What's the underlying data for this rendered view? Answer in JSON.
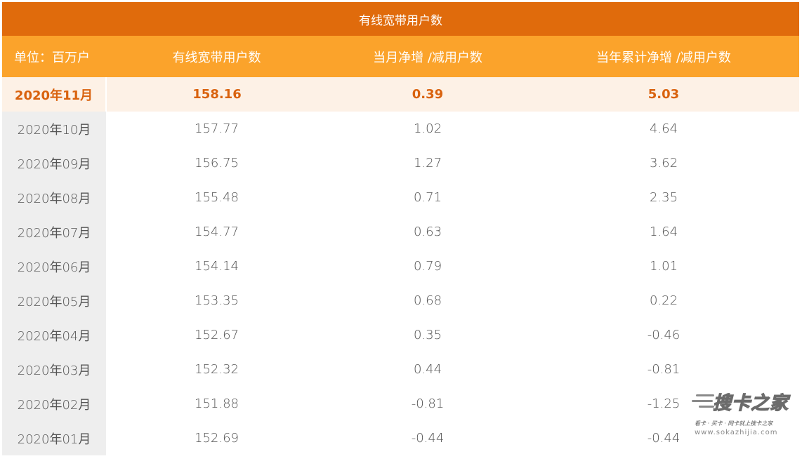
{
  "table": {
    "title": "有线宽带用户数",
    "headers": [
      "单位：百万户",
      "有线宽带用户数",
      "当月净增 /减用户数",
      "当年累计净增 /减用户数"
    ],
    "rows": [
      {
        "month": "2020年11月",
        "users": "158.16",
        "monthly_net": "0.39",
        "ytd_net": "5.03",
        "highlight": true
      },
      {
        "month": "2020年10月",
        "users": "157.77",
        "monthly_net": "1.02",
        "ytd_net": "4.64"
      },
      {
        "month": "2020年09月",
        "users": "156.75",
        "monthly_net": "1.27",
        "ytd_net": "3.62"
      },
      {
        "month": "2020年08月",
        "users": "155.48",
        "monthly_net": "0.71",
        "ytd_net": "2.35"
      },
      {
        "month": "2020年07月",
        "users": "154.77",
        "monthly_net": "0.63",
        "ytd_net": "1.64"
      },
      {
        "month": "2020年06月",
        "users": "154.14",
        "monthly_net": "0.79",
        "ytd_net": "1.01"
      },
      {
        "month": "2020年05月",
        "users": "153.35",
        "monthly_net": "0.68",
        "ytd_net": "0.22"
      },
      {
        "month": "2020年04月",
        "users": "152.67",
        "monthly_net": "0.35",
        "ytd_net": "-0.46"
      },
      {
        "month": "2020年03月",
        "users": "152.32",
        "monthly_net": "0.44",
        "ytd_net": "-0.81"
      },
      {
        "month": "2020年02月",
        "users": "151.88",
        "monthly_net": "-0.81",
        "ytd_net": "-1.25"
      },
      {
        "month": "2020年01月",
        "users": "152.69",
        "monthly_net": "-0.44",
        "ytd_net": "-0.44"
      }
    ]
  },
  "watermark": {
    "logo_text": "搜卡之家",
    "tagline": "看卡 · 买卡 · 网卡就上搜卡之家",
    "url": "www.sokazhijia.com"
  },
  "colors": {
    "title_bg": "#e06b0c",
    "header_bg": "#fba32b",
    "highlight_bg": "#fdf1e6",
    "highlight_text": "#d9620e",
    "first_col_bg": "#eeeeee"
  }
}
